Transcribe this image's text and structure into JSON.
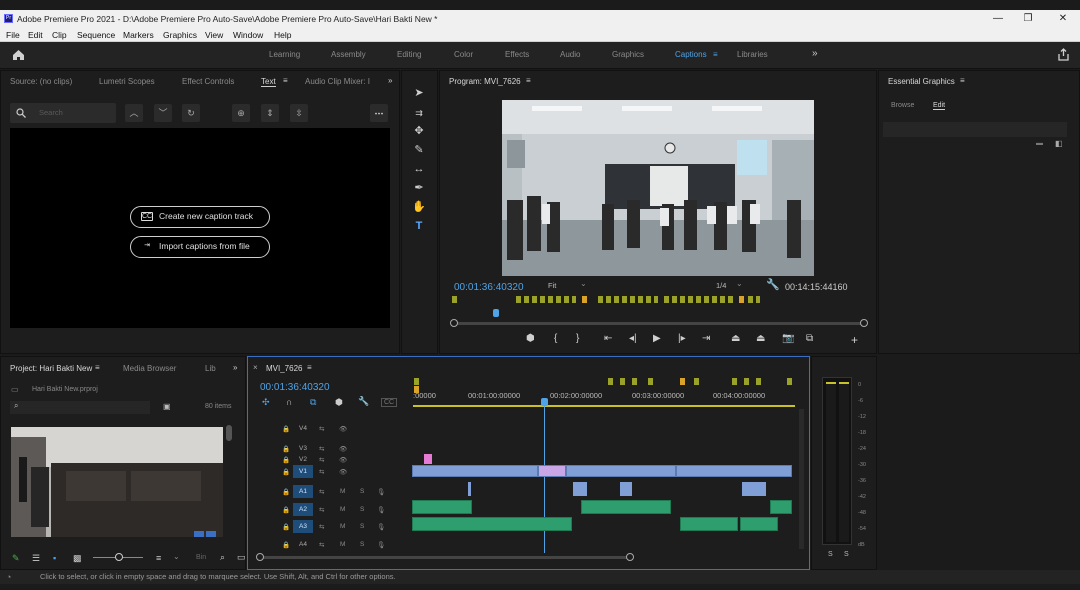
{
  "window": {
    "title": "Adobe Premiere Pro 2021 - D:\\Adobe Premiere Pro Auto-Save\\Adobe Premiere Pro Auto-Save\\Hari Bakti New *",
    "app_icon": "Pr"
  },
  "menu": [
    "File",
    "Edit",
    "Clip",
    "Sequence",
    "Markers",
    "Graphics",
    "View",
    "Window",
    "Help"
  ],
  "workspaces": {
    "items": [
      "Learning",
      "Assembly",
      "Editing",
      "Color",
      "Effects",
      "Audio",
      "Graphics",
      "Captions",
      "Libraries"
    ],
    "active": "Captions",
    "more": "»"
  },
  "source_panel": {
    "tabs": [
      "Source: (no clips)",
      "Lumetri Scopes",
      "Effect Controls",
      "Text",
      "Audio Clip Mixer: I"
    ],
    "active_tab": "Text",
    "search_placeholder": "Search",
    "create_caption_label": "Create new caption track",
    "import_captions_label": "Import captions from file"
  },
  "program_monitor": {
    "title": "Program: MVI_7626",
    "timecode": "00:01:36:40320",
    "fit": "Fit",
    "resolution": "1/4",
    "duration": "00:14:15:44160"
  },
  "essential_graphics": {
    "title": "Essential Graphics",
    "tabs": [
      "Browse",
      "Edit"
    ],
    "active_tab": "Edit"
  },
  "project_panel": {
    "tabs": [
      "Project: Hari Bakti New",
      "Media Browser",
      "Lib"
    ],
    "project_file": "Hari Bakti New.prproj",
    "item_count": "80 items",
    "zoom_label": "Bin"
  },
  "timeline": {
    "sequence": "MVI_7626",
    "timecode": "00:01:36:40320",
    "ruler": [
      ":00000",
      "00:01:00:00000",
      "00:02:00:00000",
      "00:03:00:00000",
      "00:04:00:00000"
    ],
    "video_tracks": [
      "V4",
      "V3",
      "V2",
      "V1"
    ],
    "audio_tracks": [
      "A1",
      "A2",
      "A3",
      "A4"
    ],
    "mute_label": "M",
    "solo_label": "S",
    "fx_label": "fx"
  },
  "audio_meter": {
    "scale": [
      "0",
      "-6",
      "-12",
      "-18",
      "-24",
      "-30",
      "-36",
      "-42",
      "-48",
      "-54",
      "dB"
    ],
    "solo": [
      "S",
      "S"
    ]
  },
  "status_bar": "Click to select, or click in empty space and drag to marquee select. Use Shift, Alt, and Ctrl for other options."
}
